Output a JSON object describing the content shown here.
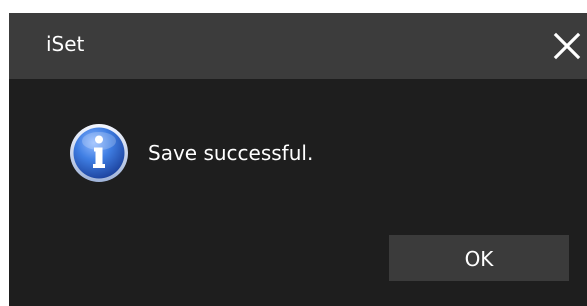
{
  "window": {
    "title": "iSet",
    "close_icon": "close-icon"
  },
  "content": {
    "icon": "info-icon",
    "message": "Save successful."
  },
  "buttons": {
    "ok_label": "OK"
  },
  "colors": {
    "titlebar_bg": "#3c3c3c",
    "body_bg": "#1e1e1e",
    "button_bg": "#3b3b3b",
    "icon_blue": "#2a62c9",
    "text": "#ffffff"
  }
}
